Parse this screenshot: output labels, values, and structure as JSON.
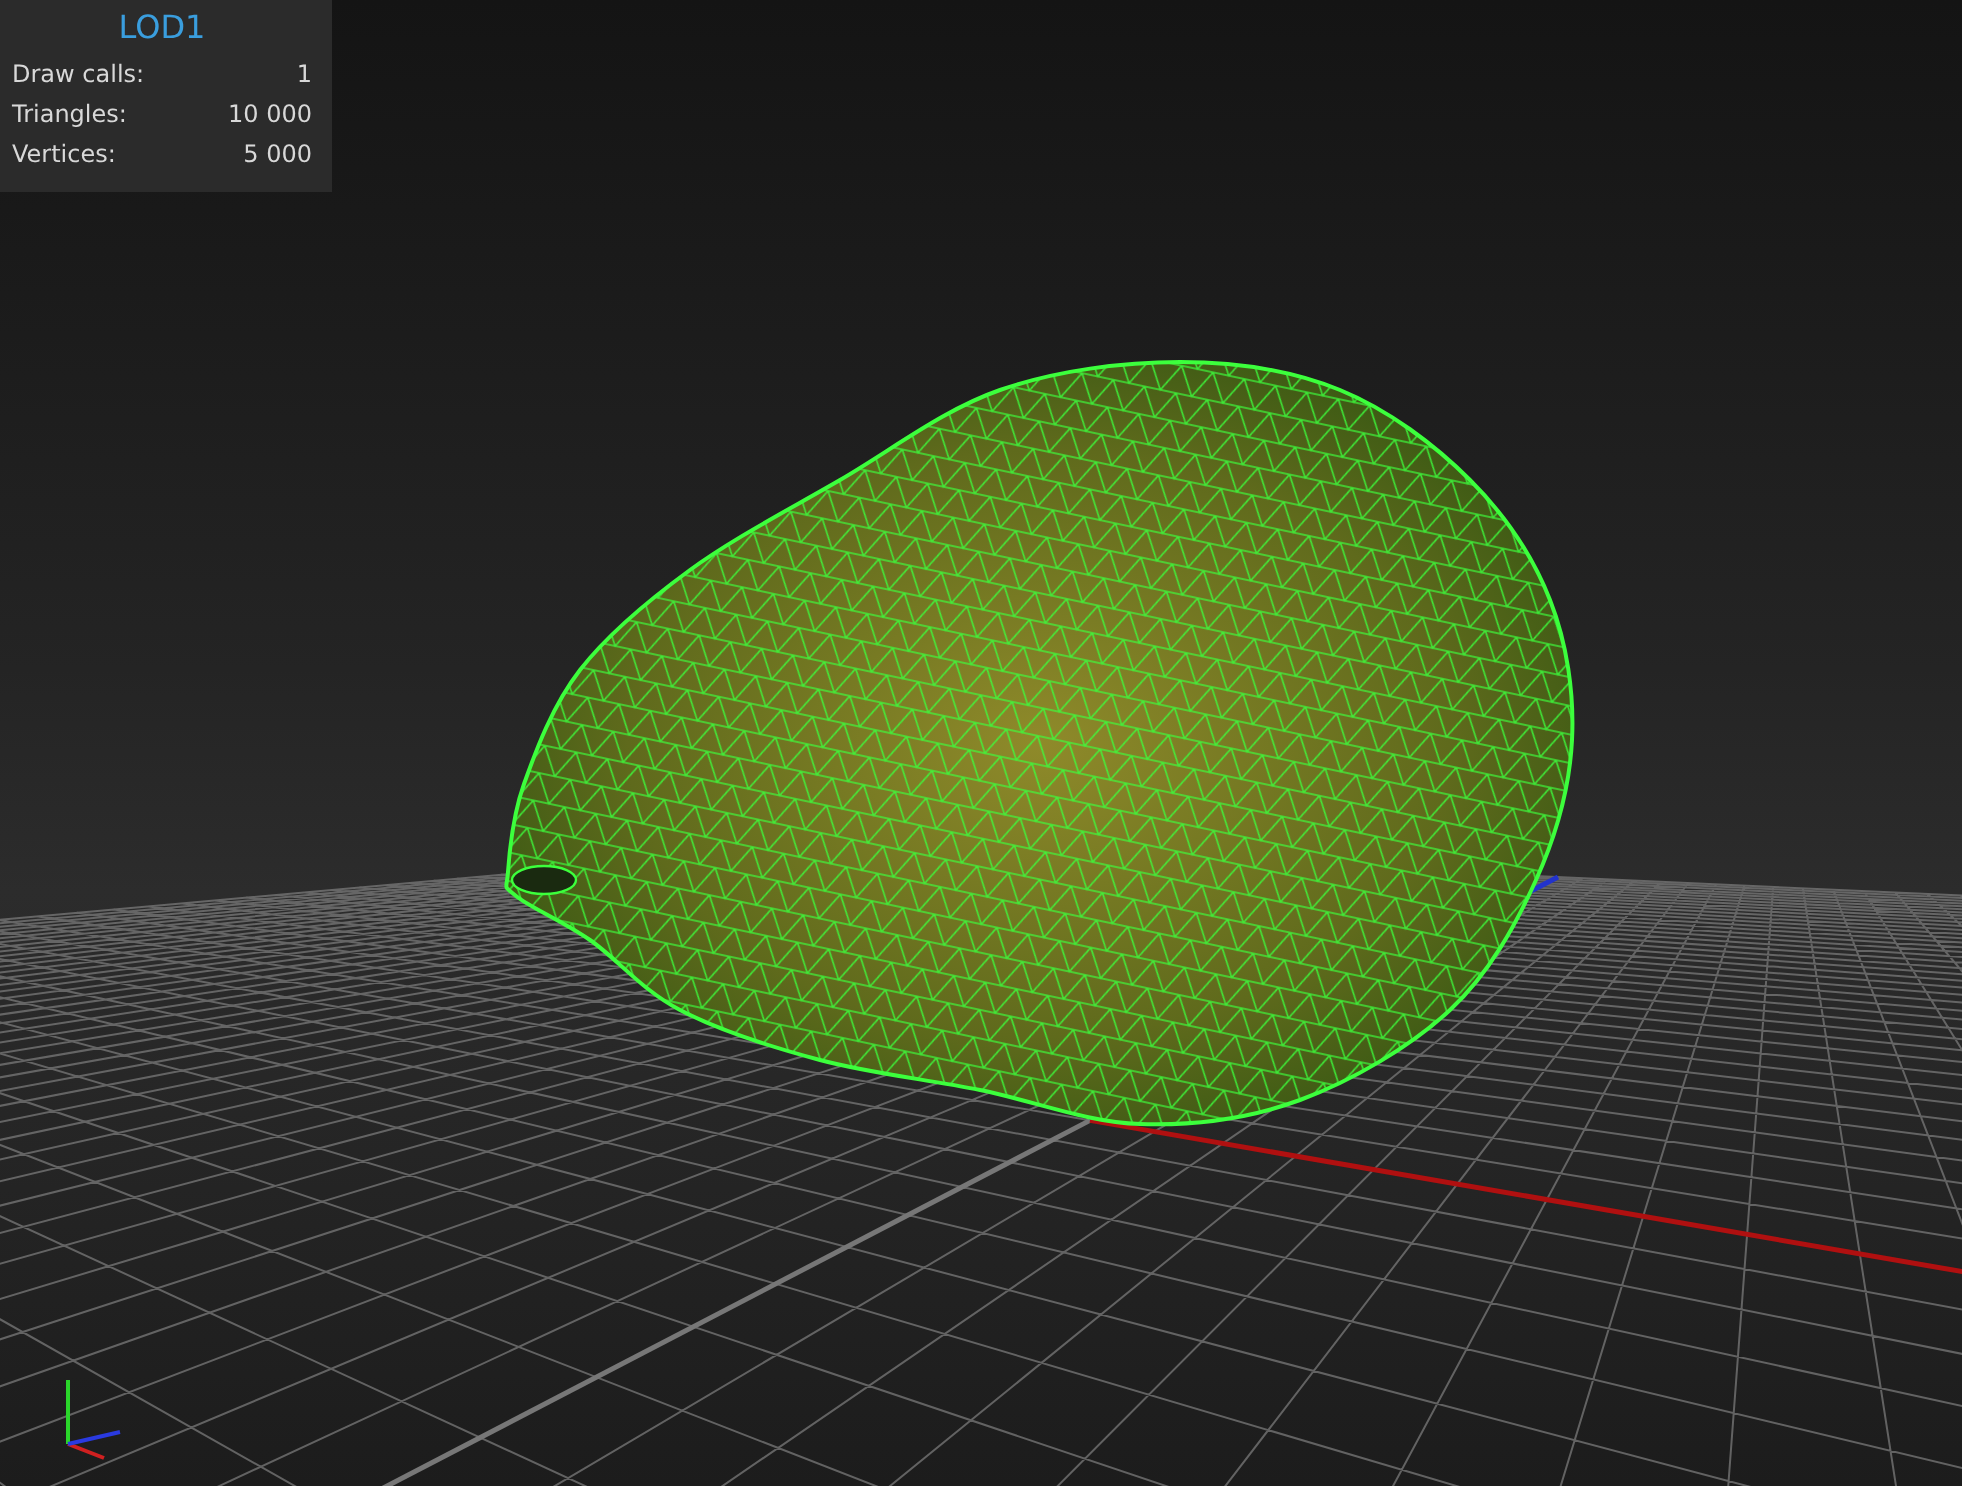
{
  "lod_panel": {
    "title": "LOD1",
    "stats": [
      {
        "label": "Draw calls:",
        "value": "1"
      },
      {
        "label": "Triangles:",
        "value": "10 000"
      },
      {
        "label": "Vertices:",
        "value": "5 000"
      }
    ]
  }
}
